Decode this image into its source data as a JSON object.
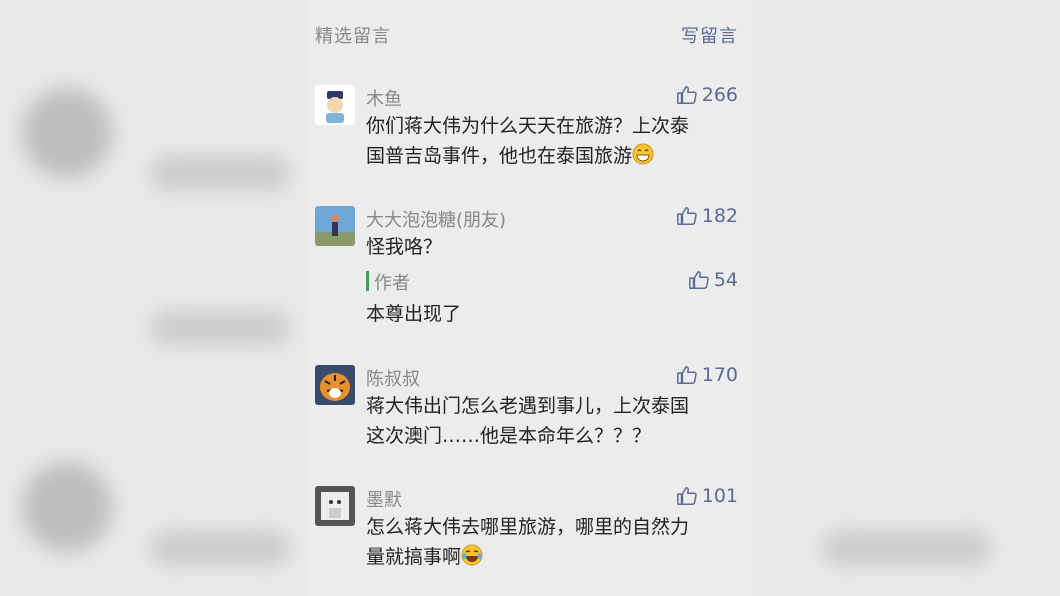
{
  "header": {
    "title": "精选留言",
    "write": "写留言"
  },
  "comments": [
    {
      "name": "木鱼",
      "likes": "266",
      "lines": [
        "你们蒋大伟为什么天天在旅游？上次泰",
        "国普吉岛事件，他也在泰国旅游"
      ],
      "emoji": "grin-emoji"
    },
    {
      "name": "大大泡泡糖(朋友)",
      "likes": "182",
      "lines": [
        "怪我咯？"
      ],
      "reply": {
        "label": "作者",
        "likes": "54",
        "text": "本尊出现了"
      }
    },
    {
      "name": "陈叔叔",
      "likes": "170",
      "lines": [
        "蒋大伟出门怎么老遇到事儿，上次泰国",
        "这次澳门……他是本命年么？？？"
      ]
    },
    {
      "name": "墨默",
      "likes": "101",
      "lines": [
        "怎么蒋大伟去哪里旅游，哪里的自然力",
        "量就搞事啊"
      ],
      "emoji": "tears-of-joy-emoji"
    }
  ],
  "colors": {
    "link": "#5a6b95",
    "reply_bar": "#2fa84f",
    "meta": "#888888"
  }
}
